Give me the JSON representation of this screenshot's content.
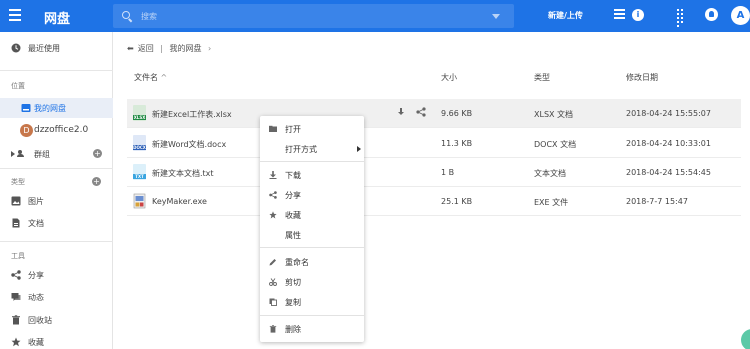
{
  "app": {
    "title": "网盘"
  },
  "search": {
    "placeholder": "搜索"
  },
  "toolbar": {
    "new_upload_label": "新建/上传",
    "avatar_letter": "A"
  },
  "sidebar": {
    "recent": "最近使用",
    "section_location": "位置",
    "my_drive": "我的网盘",
    "org_avatar_letter": "D",
    "org_name": "dzzoffice2.0",
    "groups": "群组",
    "section_type": "类型",
    "images": "图片",
    "documents": "文档",
    "section_tools": "工具",
    "share": "分享",
    "activity": "动态",
    "recycle": "回收站",
    "favorites": "收藏"
  },
  "breadcrumb": {
    "back": "返回",
    "separator": "|",
    "current": "我的网盘",
    "chevron": "›"
  },
  "table": {
    "headers": {
      "name": "文件名",
      "sort_indicator": "^",
      "size": "大小",
      "type": "类型",
      "modified": "修改日期"
    },
    "rows": [
      {
        "icon": "excel-file-icon",
        "badge": "XLSX",
        "name": "新建Excel工作表.xlsx",
        "size": "9.66 KB",
        "type": "XLSX 文档",
        "modified": "2018-04-24 15:55:07"
      },
      {
        "icon": "word-file-icon",
        "badge": "DOCX",
        "name": "新建Word文档.docx",
        "size": "11.3 KB",
        "type": "DOCX 文档",
        "modified": "2018-04-24 10:33:01"
      },
      {
        "icon": "text-file-icon",
        "badge": "TXT",
        "name": "新建文本文档.txt",
        "size": "1 B",
        "type": "文本文档",
        "modified": "2018-04-24 15:54:45"
      },
      {
        "icon": "exe-file-icon",
        "badge": "",
        "name": "KeyMaker.exe",
        "size": "25.1 KB",
        "type": "EXE 文件",
        "modified": "2018-7-7 15:47"
      }
    ]
  },
  "context_menu": {
    "open": "打开",
    "open_with": "打开方式",
    "download": "下载",
    "share": "分享",
    "favorite": "收藏",
    "properties": "属性",
    "rename": "重命名",
    "cut": "剪切",
    "copy": "复制",
    "delete": "删除"
  },
  "colors": {
    "primary": "#1e73e6",
    "excel": "#1f8a43",
    "word": "#2b5fb8",
    "text": "#3aa5e0",
    "active_bg": "#e9eef7"
  }
}
